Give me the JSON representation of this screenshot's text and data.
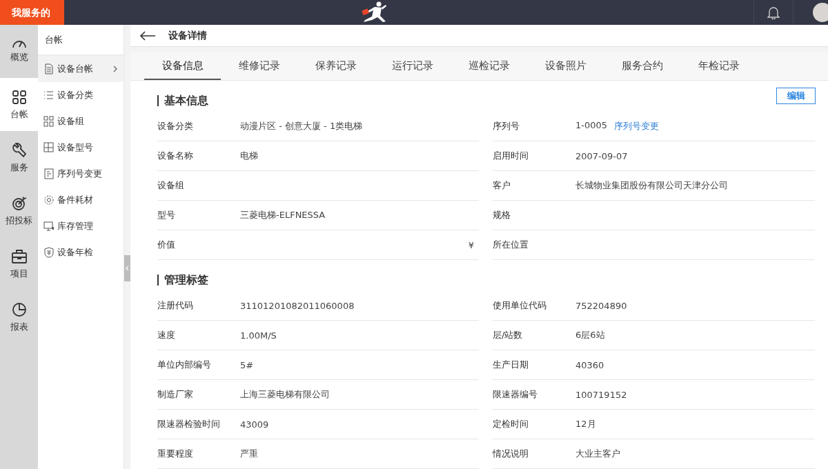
{
  "top_bar": {
    "brand": "我服务的"
  },
  "rail": [
    {
      "label": "概览",
      "selected": false
    },
    {
      "label": "台帐",
      "selected": true
    },
    {
      "label": "服务",
      "selected": false
    },
    {
      "label": "招投标",
      "selected": false
    },
    {
      "label": "项目",
      "selected": false
    },
    {
      "label": "报表",
      "selected": false
    }
  ],
  "sidebar": {
    "title": "台帐",
    "items": [
      {
        "label": "设备台帐",
        "selected": true
      },
      {
        "label": "设备分类",
        "selected": false
      },
      {
        "label": "设备组",
        "selected": false
      },
      {
        "label": "设备型号",
        "selected": false
      },
      {
        "label": "序列号变更",
        "selected": false
      },
      {
        "label": "备件耗材",
        "selected": false
      },
      {
        "label": "库存管理",
        "selected": false
      },
      {
        "label": "设备年检",
        "selected": false
      }
    ]
  },
  "page": {
    "title": "设备详情"
  },
  "tabs": [
    {
      "label": "设备信息",
      "selected": true
    },
    {
      "label": "维修记录",
      "selected": false
    },
    {
      "label": "保养记录",
      "selected": false
    },
    {
      "label": "运行记录",
      "selected": false
    },
    {
      "label": "巡检记录",
      "selected": false
    },
    {
      "label": "设备照片",
      "selected": false
    },
    {
      "label": "服务合约",
      "selected": false
    },
    {
      "label": "年检记录",
      "selected": false
    }
  ],
  "edit_button": "编辑",
  "sections": [
    {
      "title": "基本信息",
      "fields": [
        {
          "label": "设备分类",
          "value": "动漫片区 - 创意大厦 - 1类电梯"
        },
        {
          "label": "序列号",
          "value": "1-0005",
          "link": "序列号变更"
        },
        {
          "label": "设备名称",
          "value": "电梯"
        },
        {
          "label": "启用时间",
          "value": "2007-09-07"
        },
        {
          "label": "设备组"
        },
        {
          "label": "客户",
          "value": "长城物业集团股份有限公司天津分公司"
        },
        {
          "label": "型号",
          "value": "三菱电梯-ELFNESSA"
        },
        {
          "label": "规格"
        },
        {
          "label": "价值",
          "unit": "¥"
        },
        {
          "label": "所在位置"
        }
      ]
    },
    {
      "title": "管理标签",
      "fields": [
        {
          "label": "注册代码",
          "value": "31101201082011060008"
        },
        {
          "label": "使用单位代码",
          "value": "752204890"
        },
        {
          "label": "速度",
          "value": "1.00M/S"
        },
        {
          "label": "层/站数",
          "value": "6层6站"
        },
        {
          "label": "单位内部编号",
          "value": "5#"
        },
        {
          "label": "生产日期",
          "value": "40360"
        },
        {
          "label": "制造厂家",
          "value": "上海三菱电梯有限公司"
        },
        {
          "label": "限速器编号",
          "value": "100719152"
        },
        {
          "label": "限速器检验时间",
          "value": "43009"
        },
        {
          "label": "定检时间",
          "value": "12月"
        },
        {
          "label": "重要程度",
          "value": "严重"
        },
        {
          "label": "情况说明",
          "value": "大业主客户"
        }
      ]
    }
  ]
}
